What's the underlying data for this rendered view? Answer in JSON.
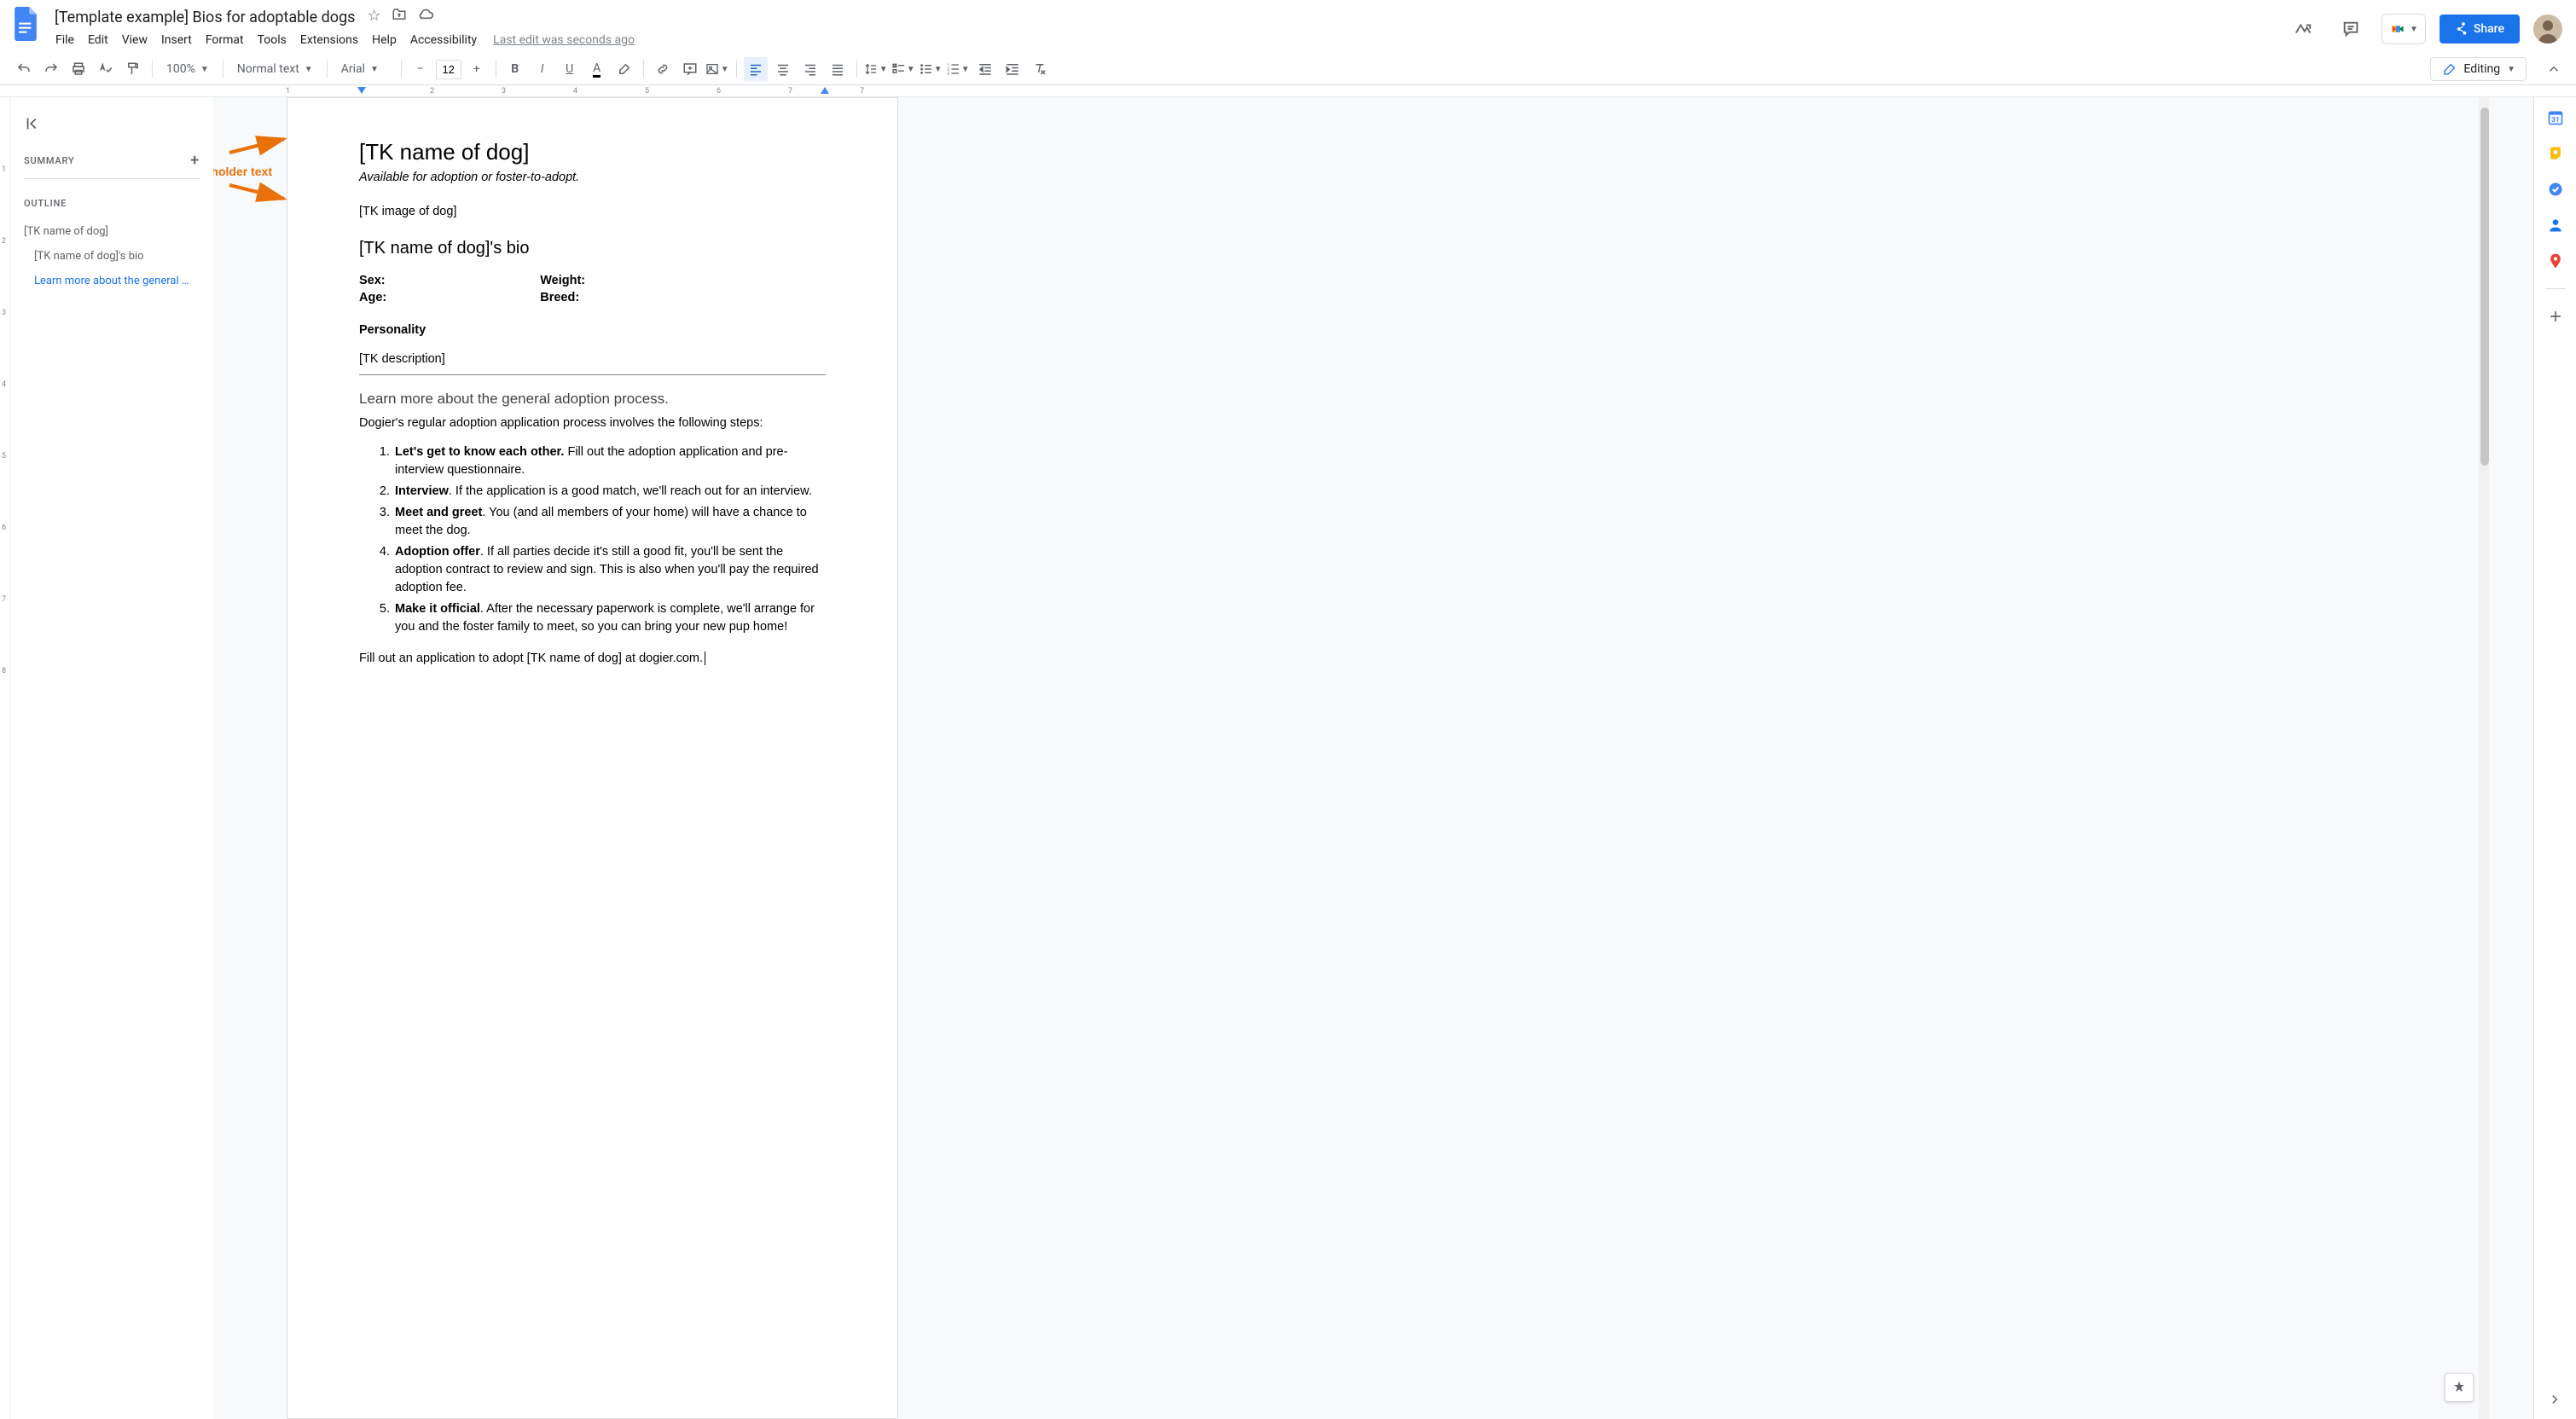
{
  "header": {
    "title": "[Template example] Bios for adoptable dogs",
    "last_edit": "Last edit was seconds ago",
    "share_label": "Share"
  },
  "menubar": [
    "File",
    "Edit",
    "View",
    "Insert",
    "Format",
    "Tools",
    "Extensions",
    "Help",
    "Accessibility"
  ],
  "toolbar": {
    "zoom": "100%",
    "style": "Normal text",
    "font": "Arial",
    "font_size": "12",
    "mode_label": "Editing"
  },
  "ruler": {
    "ticks": [
      "1",
      "2",
      "3",
      "4",
      "5",
      "6",
      "7"
    ]
  },
  "outline": {
    "summary_label": "SUMMARY",
    "outline_label": "OUTLINE",
    "items": [
      {
        "label": "[TK name of dog]",
        "level": 1,
        "active": false
      },
      {
        "label": "[TK name of dog]'s bio",
        "level": 2,
        "active": false
      },
      {
        "label": "Learn more about the general …",
        "level": 2,
        "active": true
      }
    ]
  },
  "annotation_label": "Examples of placeholder text",
  "document": {
    "h1": "[TK name of dog]",
    "subtitle": "Available for adoption or foster-to-adopt.",
    "image_placeholder": "[TK image of dog]",
    "h2": "[TK name of dog]'s bio",
    "props": {
      "sex": "Sex:",
      "age": "Age:",
      "weight": "Weight:",
      "breed": "Breed:"
    },
    "personality_label": "Personality",
    "tk_description": "[TK description]",
    "h3": "Learn more about the general adoption process.",
    "intro": "Dogier's regular adoption application process involves the following steps:",
    "steps": [
      {
        "lead": "Let's get to know each other.",
        "rest": " Fill out the adoption application and pre-interview questionnaire."
      },
      {
        "lead": "Interview",
        "rest": ". If the application is a good match, we'll reach out for an interview."
      },
      {
        "lead": "Meet and greet",
        "rest": ". You (and all members of your home) will have a chance to meet the dog."
      },
      {
        "lead": "Adoption offer",
        "rest": ". If all parties decide it's still a good fit, you'll be sent the adoption contract to review and sign. This is also when you'll pay the required adoption fee."
      },
      {
        "lead": "Make it official",
        "rest": ". After the necessary paperwork is complete, we'll arrange for you and the foster family to meet, so you can bring your new pup home!"
      }
    ],
    "footer": "Fill out an application to adopt [TK name of dog] at dogier.com."
  },
  "vruler": [
    "1",
    "2",
    "3",
    "4",
    "5",
    "6",
    "7",
    "8"
  ]
}
